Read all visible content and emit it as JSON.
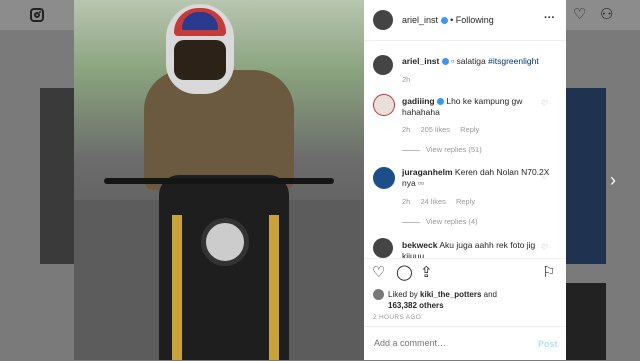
{
  "topbar": {
    "home_icon": "home-icon",
    "profile_icon": "profile-icon",
    "heart_icon": "heart-icon"
  },
  "navigation": {
    "next_arrow": "›"
  },
  "post": {
    "author": "ariel_inst",
    "separator": "•",
    "follow_label": "Following",
    "more_label": "···",
    "caption_user": "ariel_inst",
    "caption_text": "▫ salatiga",
    "caption_hashtag": "#itsgreenlight",
    "caption_time": "2h"
  },
  "comments": [
    {
      "user": "gadiiing",
      "text": "Lho ke kampung gw hahahaha",
      "time": "2h",
      "likes": "205 likes",
      "reply": "Reply",
      "view_replies": "View replies (51)"
    },
    {
      "user": "juraganhelm",
      "text": "Keren dah Nolan N70.2X nya ▫▫",
      "time": "2h",
      "likes": "24 likes",
      "reply": "Reply",
      "view_replies": "View replies (4)"
    },
    {
      "user": "bekweck",
      "text": "Aku juga aahh rek foto jig kiiuuu"
    }
  ],
  "likes": {
    "liked_by_prefix": "Liked by",
    "liked_by_user": "kiki_the_potters",
    "and": "and",
    "others": "163,382 others"
  },
  "timestamp": "2 HOURS AGO",
  "add_comment": {
    "placeholder": "Add a comment…",
    "post_label": "Post"
  },
  "colors": {
    "accent": "#3897f0",
    "text": "#262626",
    "muted": "#999999"
  }
}
